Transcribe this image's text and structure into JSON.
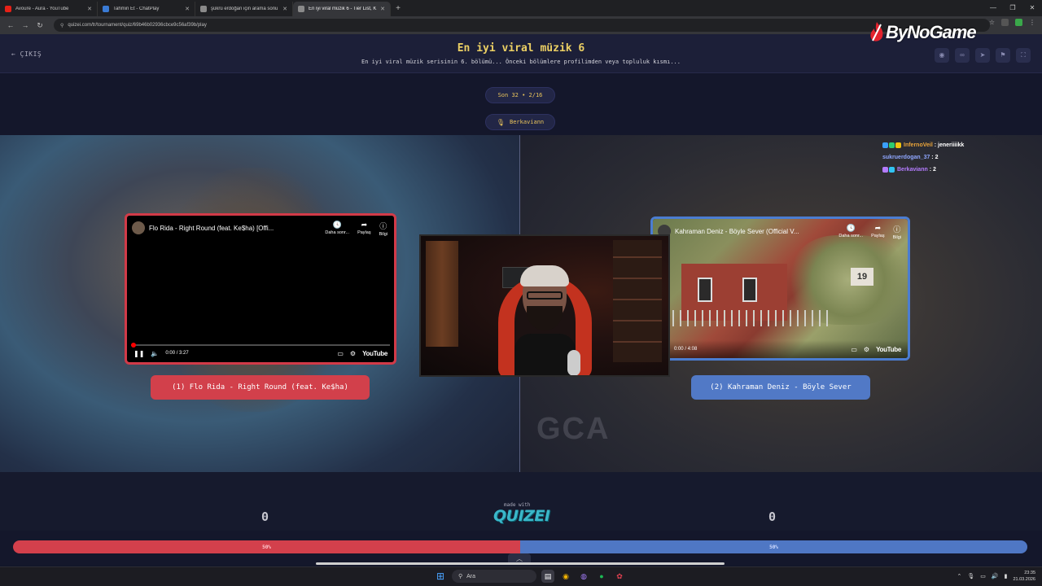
{
  "browser": {
    "tabs": [
      {
        "title": "Avoure - Aura - YouTube",
        "color": "#e62117"
      },
      {
        "title": "Tahmin Et - ChatPlay",
        "color": "#3a7bd5"
      },
      {
        "title": "şükrü erdoğan için arama sonu",
        "color": "#8a8a8a"
      },
      {
        "title": "En iyi viral müzik 6 - Tier List, K",
        "color": "#8a8a8a"
      }
    ],
    "url": "quizei.com/tr/tournament/quiz/69b46b02936cbce9c56af39b/play"
  },
  "header": {
    "exit_label": "ÇIKIŞ",
    "title": "En iyi viral müzik 6",
    "subtitle": "En iyi viral müzik serisinin 6. bölümü... Önceki bölümlere profilimden veya topluluk kısmı..."
  },
  "overlay": {
    "brand": "ByNoGame"
  },
  "round": {
    "label": "Son 32 • 2/16",
    "user": "Berkaviann"
  },
  "left": {
    "video_title": "Flo Rida - Right Round (feat. Ke$ha) [Offi...",
    "time": "0:00 / 3:27",
    "choice": "(1) Flo Rida - Right Round (feat. Ke$ha)",
    "score": "0",
    "percent_label": "50%",
    "percent": 50
  },
  "right": {
    "video_title": "Kahraman Deniz - Böyle Sever (Official V...",
    "time": "0:00 / 4:08",
    "choice": "(2) Kahraman Deniz - Böyle Sever",
    "score": "0",
    "percent_label": "50%",
    "percent": 50,
    "thumb_number": "19"
  },
  "video_controls": {
    "later": "Daha sonr...",
    "share": "Paylaş",
    "info": "Bilgi",
    "youtube": "YouTube"
  },
  "chat": [
    {
      "name": "InfernoVeil",
      "msg": "jeneriiiikk",
      "color": "#e8a33a"
    },
    {
      "name": "sukruerdogan_37",
      "msg": "2",
      "color": "#8fa7ff"
    },
    {
      "name": "Berkaviann",
      "msg": "2",
      "color": "#b47cff"
    }
  ],
  "footer": {
    "made_with": "made with",
    "logo": "QUIZEI"
  },
  "taskbar": {
    "search": "Ara",
    "time": "23:35",
    "date": "21.03.2026"
  }
}
